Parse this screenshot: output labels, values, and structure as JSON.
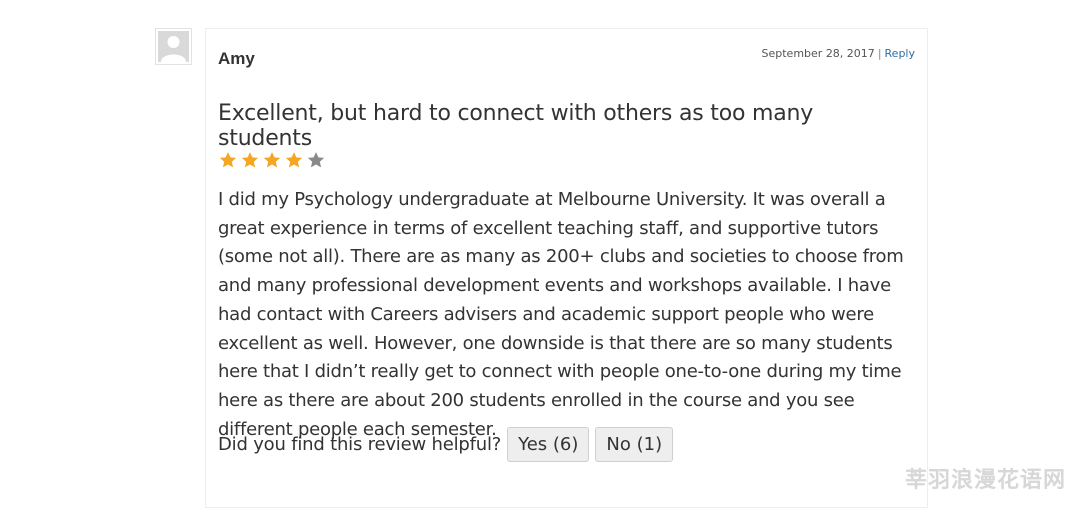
{
  "review": {
    "author": "Amy",
    "date": "September 28, 2017",
    "separator": "|",
    "reply_label": "Reply",
    "title": "Excellent, but hard to connect with others as too many students",
    "rating": {
      "value": 4,
      "max": 5,
      "filled_color": "#f5a623",
      "empty_color": "#8a8a8a"
    },
    "body": "I did my Psychology undergraduate at Melbourne University. It was overall a great experience in terms of excellent teaching staff, and supportive tutors (some not all). There are as many as 200+ clubs and societies to choose from and many professional development events and workshops available. I have had contact with Careers advisers and academic support people who were excellent as well. However, one downside is that there are so many students here that I didn’t really get to connect with people one-to-one during my time here as there are about 200 students enrolled in the course and you see different people each semester."
  },
  "helpful": {
    "question": "Did you find this review helpful?",
    "yes_label": "Yes (6)",
    "no_label": "No (1)"
  },
  "watermark": {
    "text": "莘羽浪漫花语网"
  }
}
